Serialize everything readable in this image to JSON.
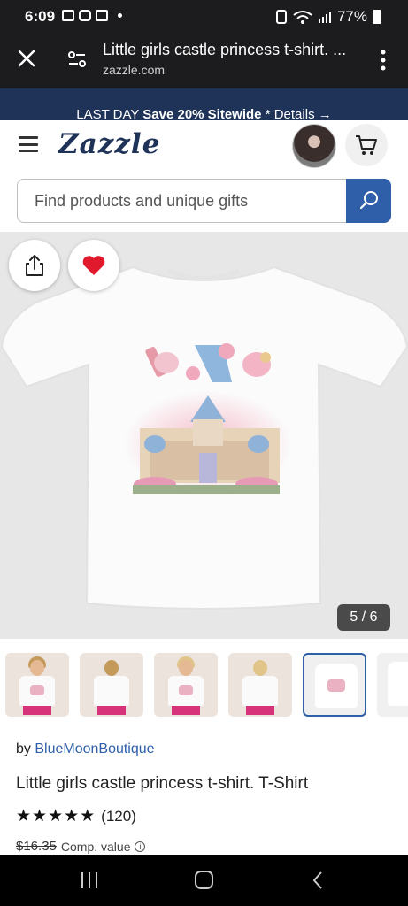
{
  "status_bar": {
    "time": "6:09",
    "battery": "77%"
  },
  "browser": {
    "page_title": "Little girls castle princess t-shirt. ...",
    "domain": "zazzle.com"
  },
  "promo": {
    "prefix": "LAST DAY ",
    "highlight": "Save 20% Sitewide",
    "asterisk": " * ",
    "details_label": "Details",
    "details_arrow": "→"
  },
  "header": {
    "logo": "Zazzle",
    "search_placeholder": "Find products and unique gifts"
  },
  "product": {
    "image_counter": "5 / 6",
    "by_prefix": "by ",
    "seller": "BlueMoonBoutique",
    "title": "Little girls castle princess t-shirt. T-Shirt",
    "stars": "★★★★★",
    "rating_count": "(120)",
    "rating_value": 4.5,
    "old_price": "$16.35",
    "comp_label": "Comp. value",
    "info_glyph": "i"
  },
  "thumbnails": [
    {
      "kind": "model-front"
    },
    {
      "kind": "model-back"
    },
    {
      "kind": "model-front"
    },
    {
      "kind": "model-back"
    },
    {
      "kind": "flat-front",
      "active": true
    },
    {
      "kind": "flat-back"
    }
  ],
  "colors": {
    "brand_navy": "#1f3358",
    "accent_blue": "#2e5fa8",
    "heart_red": "#e0192d"
  }
}
